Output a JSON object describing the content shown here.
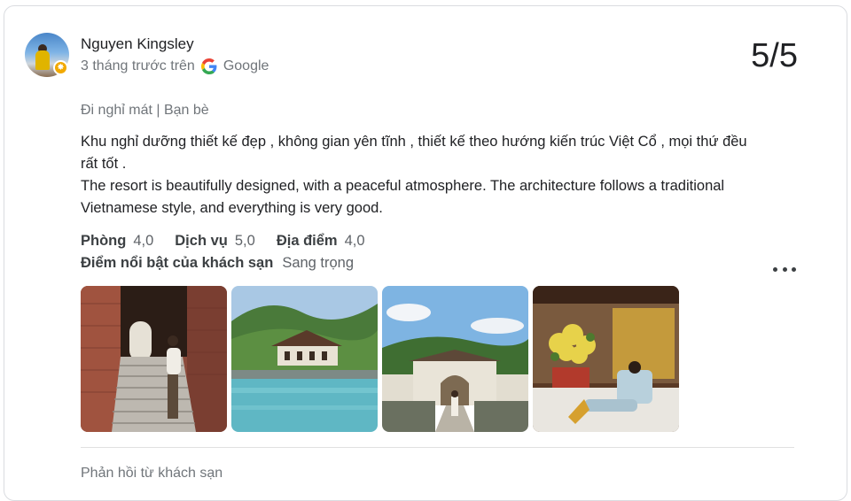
{
  "reviewer": {
    "name": "Nguyen Kingsley",
    "time": "3 tháng trước trên",
    "source": "Google"
  },
  "score": "5/5",
  "trip_tags": "Đi nghỉ mát | Bạn bè",
  "review": {
    "vi": "Khu nghỉ dưỡng thiết kế đẹp , không gian yên tĩnh , thiết kế theo hướng kiến trúc Việt Cổ , mọi thứ đều rất tốt .",
    "en": "The resort is beautifully designed, with a peaceful atmosphere. The architecture follows a traditional Vietnamese style, and everything is very good."
  },
  "ratings": [
    {
      "label": "Phòng",
      "value": "4,0"
    },
    {
      "label": "Dịch vụ",
      "value": "5,0"
    },
    {
      "label": "Địa điểm",
      "value": "4,0"
    }
  ],
  "highlight": {
    "label": "Điểm nổi bật của khách sạn",
    "value": "Sang trọng"
  },
  "reply_heading": "Phản hồi từ khách sạn",
  "photos": [
    "brick-stairway-photo",
    "pool-villa-photo",
    "gate-courtyard-photo",
    "lounge-flowers-photo"
  ],
  "colors": {
    "text": "#202124",
    "secondary": "#70757a",
    "border": "#dadce0",
    "badge": "#f2a900"
  }
}
